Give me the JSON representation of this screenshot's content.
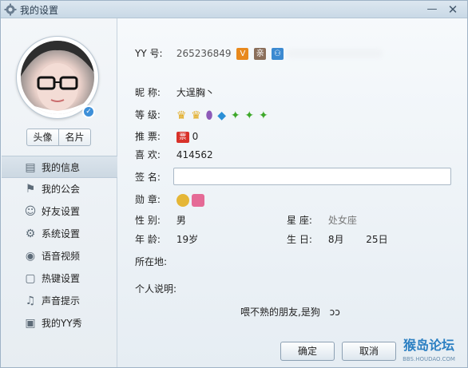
{
  "window": {
    "title": "我的设置",
    "title_icon": "gear-icon",
    "minimize_label": "—",
    "close_label": "✕"
  },
  "sidebar": {
    "tabs": [
      "头像",
      "名片"
    ],
    "items": [
      {
        "label": "我的信息",
        "icon": "profile-card-icon",
        "active": true
      },
      {
        "label": "我的公会",
        "icon": "flag-icon"
      },
      {
        "label": "好友设置",
        "icon": "friends-icon"
      },
      {
        "label": "系统设置",
        "icon": "gear-icon"
      },
      {
        "label": "语音视频",
        "icon": "headset-icon"
      },
      {
        "label": "热键设置",
        "icon": "hotkey-icon"
      },
      {
        "label": "声音提示",
        "icon": "music-note-icon"
      },
      {
        "label": "我的YY秀",
        "icon": "wardrobe-icon"
      }
    ]
  },
  "profile": {
    "yy_label": "YY 号:",
    "yy_number": "265236849",
    "nickname_label": "昵 称:",
    "nickname": "大逞胸丶",
    "level_label": "等 级:",
    "recommend_label": "推 票:",
    "recommend_value": "0",
    "likes_label": "喜 欢:",
    "likes_value": "414562",
    "signature_label": "签 名:",
    "signature_value": "",
    "medal_label": "勋 章:",
    "gender_label": "性 别:",
    "gender_value": "男",
    "zodiac_label": "星 座:",
    "zodiac_value": "处女座",
    "age_label": "年 龄:",
    "age_value": "19岁",
    "birthday_label": "生 日:",
    "birthday_month": "8月",
    "birthday_day": "25日",
    "location_label": "所在地:",
    "location_value": "",
    "bio_label": "个人说明:",
    "bio_value": "喂不熟的朋友,是狗",
    "bio_suffix": "ɔɔ"
  },
  "buttons": {
    "ok": "确定",
    "cancel": "取消"
  },
  "watermark": {
    "text": "猴岛论坛",
    "sub": "BBS.HOUDAO.COM"
  }
}
